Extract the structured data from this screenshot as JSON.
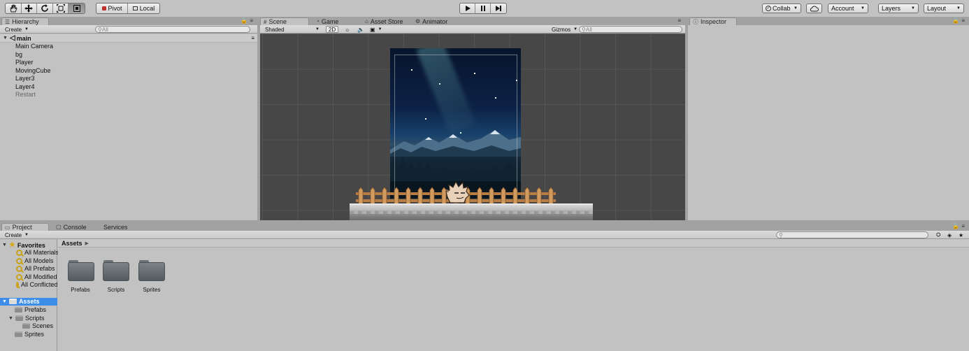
{
  "toolbar": {
    "tools": [
      "hand-icon",
      "move-icon",
      "rotate-icon",
      "scale-icon",
      "rect-icon"
    ],
    "pivot_label": "Pivot",
    "local_label": "Local",
    "play_icons": [
      "play-icon",
      "pause-icon",
      "step-icon"
    ],
    "collab_label": "Collab",
    "account_label": "Account",
    "layers_label": "Layers",
    "layout_label": "Layout"
  },
  "hierarchy": {
    "tab_label": "Hierarchy",
    "create_label": "Create",
    "search_placeholder": "All",
    "scene_name": "main",
    "items": [
      "Main Camera",
      "bg",
      "Player",
      "MovingCube",
      "Layer3",
      "Layer4",
      "Restart"
    ]
  },
  "scene": {
    "tabs": [
      "Scene",
      "Game",
      "Asset Store",
      "Animator"
    ],
    "shading_mode": "Shaded",
    "mode_2d_label": "2D",
    "gizmos_label": "Gizmos",
    "search_placeholder": "All"
  },
  "inspector": {
    "tab_label": "Inspector"
  },
  "project": {
    "tabs": [
      "Project",
      "Console",
      "Services"
    ],
    "create_label": "Create",
    "favorites_label": "Favorites",
    "favorites": [
      "All Materials",
      "All Models",
      "All Prefabs",
      "All Modified",
      "All Conflicted"
    ],
    "assets_label": "Assets",
    "tree": [
      "Prefabs",
      "Scripts",
      "Scenes",
      "Sprites"
    ],
    "breadcrumb": "Assets",
    "folders": [
      "Prefabs",
      "Scripts",
      "Sprites"
    ]
  },
  "colors": {
    "selection": "#3c8cea",
    "panel_bg": "#c2c2c2",
    "scene_bg": "#474747"
  }
}
